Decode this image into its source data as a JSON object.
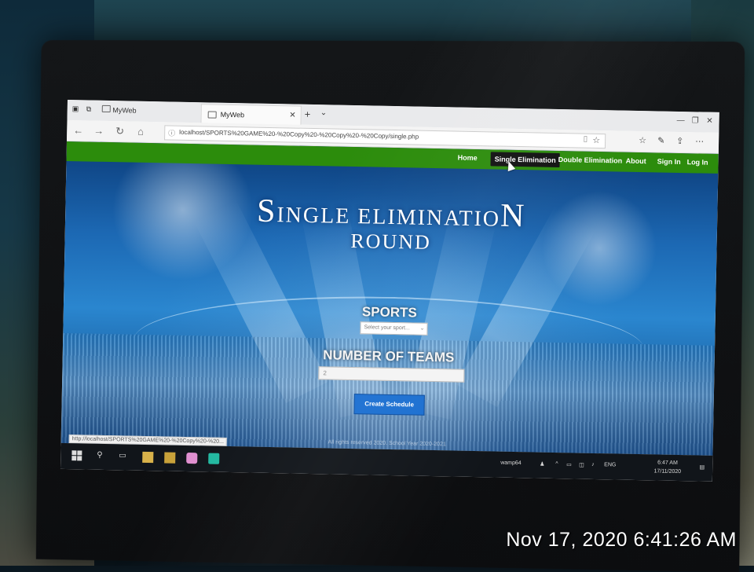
{
  "browser": {
    "tabs": [
      {
        "label": "MyWeb"
      },
      {
        "label": "MyWeb"
      }
    ],
    "new_tab_symbol": "+",
    "address": "localhost/SPORTS%20GAME%20-%20Copy%20-%20Copy%20-%20Copy/single.php",
    "icons": [
      "back-icon",
      "forward-icon",
      "refresh-icon",
      "home-icon",
      "info-icon",
      "reading-view-icon",
      "favorite-star-icon",
      "favorites-hub-icon",
      "pen-icon",
      "share-icon",
      "more-icon"
    ]
  },
  "nav": {
    "items": [
      "Home",
      "Single Elimination",
      "Double Elimination",
      "About",
      "Sign In",
      "Log In"
    ],
    "active": "Single Elimination"
  },
  "hero": {
    "title_line1_initial": "S",
    "title_line1_middle": "INGLE ELIMINATIO",
    "title_line1_final": "N",
    "title_line2": "ROUND"
  },
  "form": {
    "sports_label": "SPORTS",
    "sports_placeholder": "Select your sport...",
    "teams_label": "NUMBER OF TEAMS",
    "teams_value": "2",
    "create_button": "Create Schedule"
  },
  "footer": "All rights reserved 2020. School Year 2020-2021",
  "status_url": "http://localhost/SPORTS%20GAME%20-%20Copy%20-%20...",
  "taskbar": {
    "tray_app": "wamp64",
    "lang": "ENG",
    "time": "6:47 AM",
    "date": "17/11/2020"
  },
  "photo_timestamp": "Nov 17, 2020 6:41:26 AM",
  "colors": {
    "navbar": "#2c8c0c",
    "button": "#1b6fd1",
    "active_nav": "#111111"
  }
}
